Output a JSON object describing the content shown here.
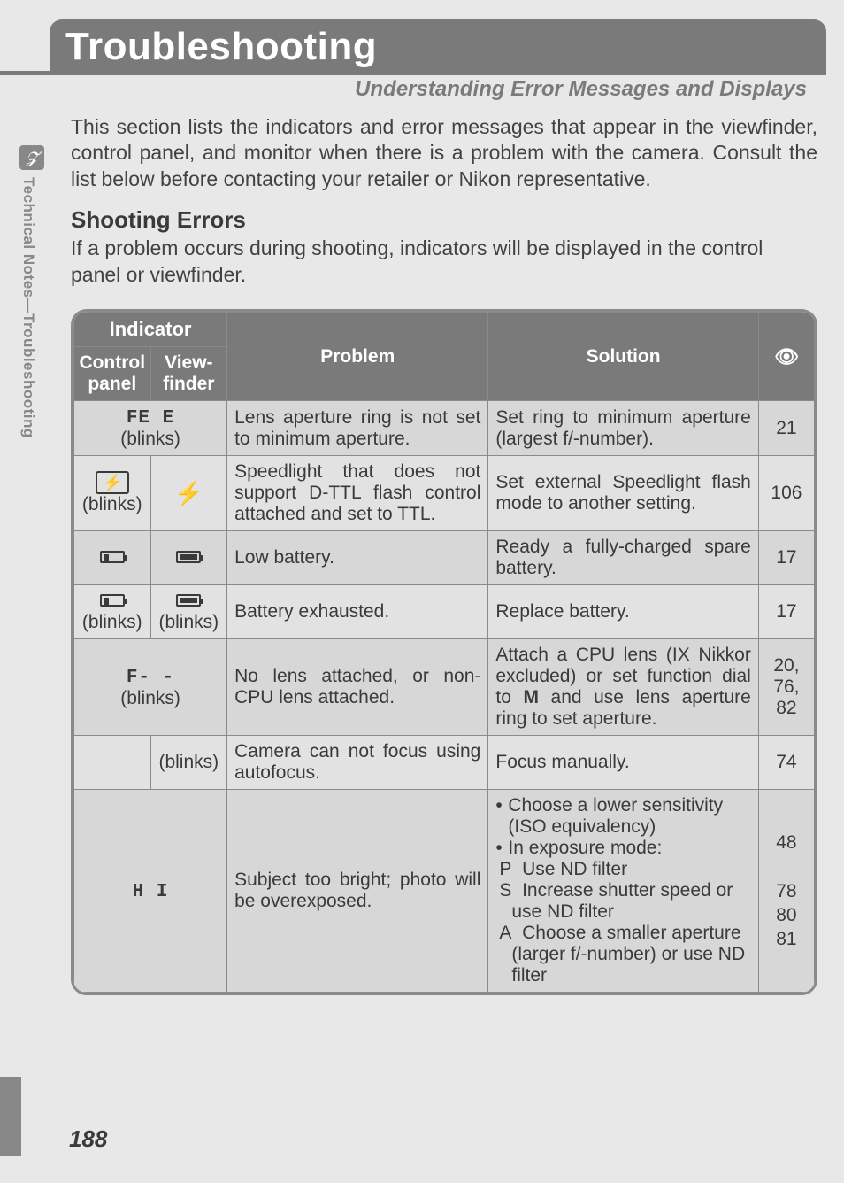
{
  "page_title": "Troubleshooting",
  "subtitle": "Understanding Error Messages and Displays",
  "intro": "This section lists the indicators and error messages that appear in the viewfinder, control panel, and monitor when there is a problem with the camera.  Consult the list below before contacting your retailer or Nikon representative.",
  "section_heading": "Shooting Errors",
  "section_text": "If a problem occurs during shooting, indicators will be displayed in the control panel or viewfinder.",
  "side_label": "Technical Notes—Troubleshooting",
  "page_number": "188",
  "table": {
    "head": {
      "indicator": "Indicator",
      "control_panel": "Control panel",
      "viewfinder": "View-finder",
      "problem": "Problem",
      "solution": "Solution"
    },
    "rows": [
      {
        "cp_text": "FE E",
        "cp_sub": "(blinks)",
        "cp_colspan": true,
        "problem": "Lens aperture ring is not set to minimum aperture.",
        "solution": "Set ring to minimum aperture (largest f/-number).",
        "page": "21"
      },
      {
        "cp_icon": "flash-box",
        "cp_sub": "(blinks)",
        "vf_icon": "flash",
        "problem": "Speedlight that does not support D-TTL flash control attached and set to TTL.",
        "solution": "Set external Speedlight flash mode to another setting.",
        "page": "106"
      },
      {
        "cp_icon": "batt-low",
        "vf_icon": "batt-full",
        "problem": "Low battery.",
        "solution": "Ready a fully-charged spare battery.",
        "page": "17"
      },
      {
        "cp_icon": "batt-low",
        "cp_sub": "(blinks)",
        "vf_icon": "batt-full",
        "vf_sub": "(blinks)",
        "problem": "Battery exhausted.",
        "solution": "Replace battery.",
        "page": "17"
      },
      {
        "cp_text": "F- -",
        "cp_sub": "(blinks)",
        "cp_colspan": true,
        "problem": "No lens attached, or non-CPU lens attached.",
        "solution": "Attach a CPU lens (IX Nikkor excluded) or set function dial to M and use lens aperture ring to set aperture.",
        "page": "20, 76, 82"
      },
      {
        "vf_sub": "(blinks)",
        "problem": "Camera can not focus using autofocus.",
        "solution": "Focus manually.",
        "page": "74"
      },
      {
        "cp_text": "H I",
        "cp_colspan": true,
        "problem": "Subject too bright; photo will be overexposed.",
        "solution_list": {
          "l1": "Choose a lower sensitivity (ISO equivalency)",
          "l2": "In exposure mode:",
          "p": "Use ND filter",
          "s": "Increase shutter speed or use ND filter",
          "a": "Choose a smaller aperture (larger f/-number) or use ND filter"
        },
        "pages_multi": {
          "p1": "48",
          "p2": "78",
          "p3": "80",
          "p4": "81"
        }
      }
    ]
  }
}
